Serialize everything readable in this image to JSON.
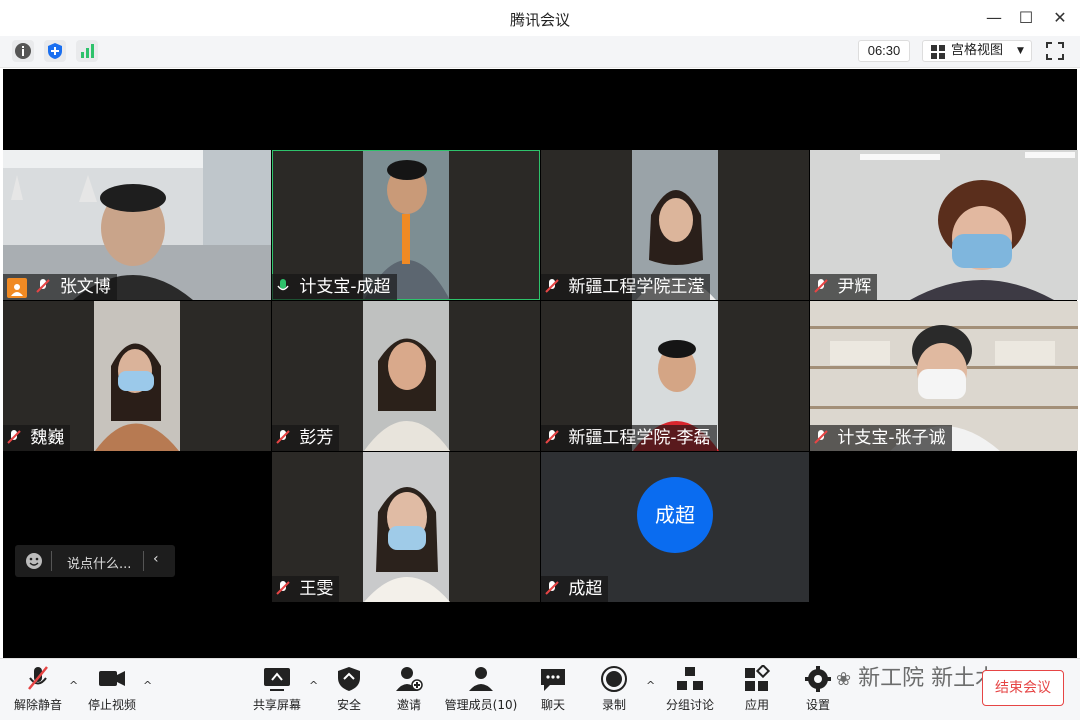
{
  "window": {
    "title": "腾讯会议"
  },
  "infobar": {
    "timer": "06:30",
    "view_label": "宫格视图"
  },
  "participants": [
    {
      "name": "张文博",
      "host": true
    },
    {
      "name": "计支宝-成超",
      "speaking": true
    },
    {
      "name": "新疆工程学院王滢"
    },
    {
      "name": "尹辉"
    },
    {
      "name": "魏巍"
    },
    {
      "name": "彭芳"
    },
    {
      "name": "新疆工程学院-李磊"
    },
    {
      "name": "计支宝-张子诚"
    },
    {
      "name": "王雯"
    },
    {
      "name": "成超",
      "avatar_text": "成超"
    }
  ],
  "chat": {
    "placeholder": "说点什么..."
  },
  "toolbar": {
    "unmute": "解除静音",
    "stop_video": "停止视频",
    "share_screen": "共享屏幕",
    "security": "安全",
    "invite": "邀请",
    "manage_members": "管理成员(10)",
    "chat": "聊天",
    "record": "录制",
    "breakout": "分组讨论",
    "apps": "应用",
    "settings": "设置",
    "end_meeting": "结束会议"
  },
  "watermark": "新工院 新土木",
  "colors": {
    "accent_blue": "#0a6cf0",
    "speaking_green": "#2ec26b",
    "end_red": "#e64545",
    "host_orange": "#f08a24"
  }
}
